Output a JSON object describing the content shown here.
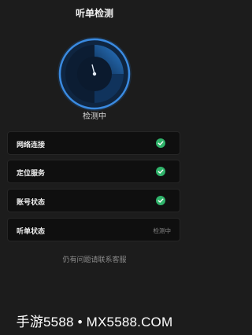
{
  "header": {
    "title": "听单检测"
  },
  "detector": {
    "status_text": "检测中",
    "icon": "radar-scan-icon"
  },
  "checks": [
    {
      "label": "网络连接",
      "status": "ok",
      "icon": "check-circle-icon"
    },
    {
      "label": "定位服务",
      "status": "ok",
      "icon": "check-circle-icon"
    },
    {
      "label": "账号状态",
      "status": "ok",
      "icon": "check-circle-icon"
    },
    {
      "label": "听单状态",
      "status": "checking",
      "value": "检测中"
    }
  ],
  "footer": {
    "help_link": "仍有问题请联系客服"
  },
  "watermark": "手游5588 • MX5588.COM",
  "colors": {
    "background": "#1c1c1c",
    "card": "#0f0f0f",
    "accent": "#2b7fd4",
    "success": "#2fb36a"
  }
}
